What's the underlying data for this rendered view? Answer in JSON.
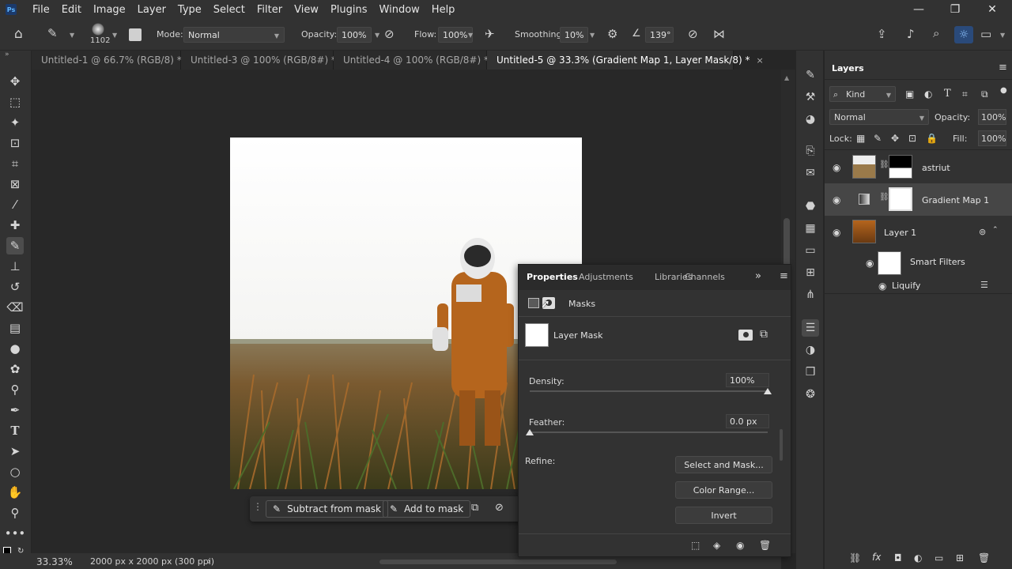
{
  "menubar": {
    "app_badge": "Ps",
    "items": [
      "File",
      "Edit",
      "Image",
      "Layer",
      "Type",
      "Select",
      "Filter",
      "View",
      "Plugins",
      "Window",
      "Help"
    ],
    "minimize": "—",
    "restore": "❐",
    "close": "✕"
  },
  "options": {
    "brush_size": "1102",
    "mode_label": "Mode:",
    "mode_value": "Normal",
    "opacity_label": "Opacity:",
    "opacity_value": "100%",
    "flow_label": "Flow:",
    "flow_value": "100%",
    "smoothing_label": "Smoothing:",
    "smoothing_value": "10%",
    "angle_value": "139°"
  },
  "tabs": [
    {
      "label": "Untitled-1 @ 66.7% (RGB/8) *",
      "close": "×"
    },
    {
      "label": "Untitled-3 @ 100% (RGB/8#) *",
      "close": "×"
    },
    {
      "label": "Untitled-4 @ 100% (RGB/8#) *",
      "close": "×"
    },
    {
      "label": "Untitled-5 @ 33.3% (Gradient Map 1, Layer Mask/8) *",
      "close": "×"
    }
  ],
  "context_bar": {
    "subtract_label": "Subtract from mask",
    "add_label": "Add to mask",
    "more": "•••"
  },
  "status": {
    "zoom": "33.33%",
    "doc_size": "2000 px x 2000 px (300 ppi)",
    "arrow": "›"
  },
  "properties": {
    "tabs": [
      "Properties",
      "Adjustments",
      "Libraries",
      "Channels"
    ],
    "expand": "»",
    "menu": "≡",
    "section_label": "Masks",
    "mask_type": "Layer Mask",
    "density_label": "Density:",
    "density_value": "100%",
    "density_fraction": 1.0,
    "feather_label": "Feather:",
    "feather_value": "0.0 px",
    "feather_fraction": 0.0,
    "refine_label": "Refine:",
    "select_and_mask": "Select and Mask...",
    "color_range": "Color Range...",
    "invert": "Invert"
  },
  "layers_panel": {
    "title": "Layers",
    "kind_filter": "Kind",
    "blend_mode": "Normal",
    "opacity_label": "Opacity:",
    "opacity_value": "100%",
    "lock_label": "Lock:",
    "fill_label": "Fill:",
    "fill_value": "100%",
    "layers": [
      {
        "name": "astriut"
      },
      {
        "name": "Gradient Map 1"
      },
      {
        "name": "Layer 1"
      },
      {
        "name": "Smart Filters"
      },
      {
        "name": "Liquify"
      }
    ]
  },
  "colors": {
    "accent": "#1473e6",
    "panel_bg": "#323232",
    "canvas_bg": "#282828"
  }
}
